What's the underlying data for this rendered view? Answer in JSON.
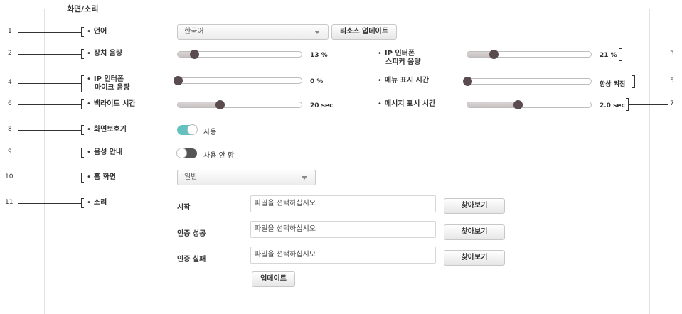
{
  "panel": {
    "title": "화면/소리"
  },
  "callouts": [
    "1",
    "2",
    "3",
    "4",
    "5",
    "6",
    "7",
    "8",
    "9",
    "10",
    "11"
  ],
  "settings": {
    "language": {
      "label": "언어",
      "value": "한국어",
      "button": "리소스 업데이트"
    },
    "device_volume": {
      "label": "장치 음량",
      "value": "13 %",
      "level_percent": 13
    },
    "ip_speaker_volume": {
      "label_line1": "IP 인터폰",
      "label_line2": "스피커 음량",
      "value": "21 %",
      "level_percent": 21
    },
    "ip_mic_volume": {
      "label_line1": "IP 인터폰",
      "label_line2": "마이크 음량",
      "value": "0 %",
      "level_percent": 0
    },
    "menu_display_time": {
      "label": "메뉴 표시 시간",
      "value": "항상 켜짐",
      "level_percent": 0
    },
    "backlight_time": {
      "label": "백라이트 시간",
      "value": "20 sec",
      "level_percent": 34
    },
    "message_display_time": {
      "label": "메시지 표시 시간",
      "value": "2.0 sec",
      "level_percent": 41
    },
    "screensaver": {
      "label": "화면보호기",
      "state": "사용",
      "enabled": true
    },
    "voice_guide": {
      "label": "음성 안내",
      "state": "사용 안 함",
      "enabled": false
    },
    "home_screen": {
      "label": "홈 화면",
      "value": "일반"
    },
    "sound": {
      "label": "소리",
      "rows": [
        {
          "label": "시작",
          "placeholder": "파일을 선택하십시오",
          "button": "찾아보기"
        },
        {
          "label": "인증 성공",
          "placeholder": "파일을 선택하십시오",
          "button": "찾아보기"
        },
        {
          "label": "인증 실패",
          "placeholder": "파일을 선택하십시오",
          "button": "찾아보기"
        }
      ],
      "update_button": "업데이트"
    }
  },
  "colors": {
    "toggle_on": "#63c2c0",
    "toggle_off": "#555555",
    "slider_knob": "#5a4b4f"
  }
}
